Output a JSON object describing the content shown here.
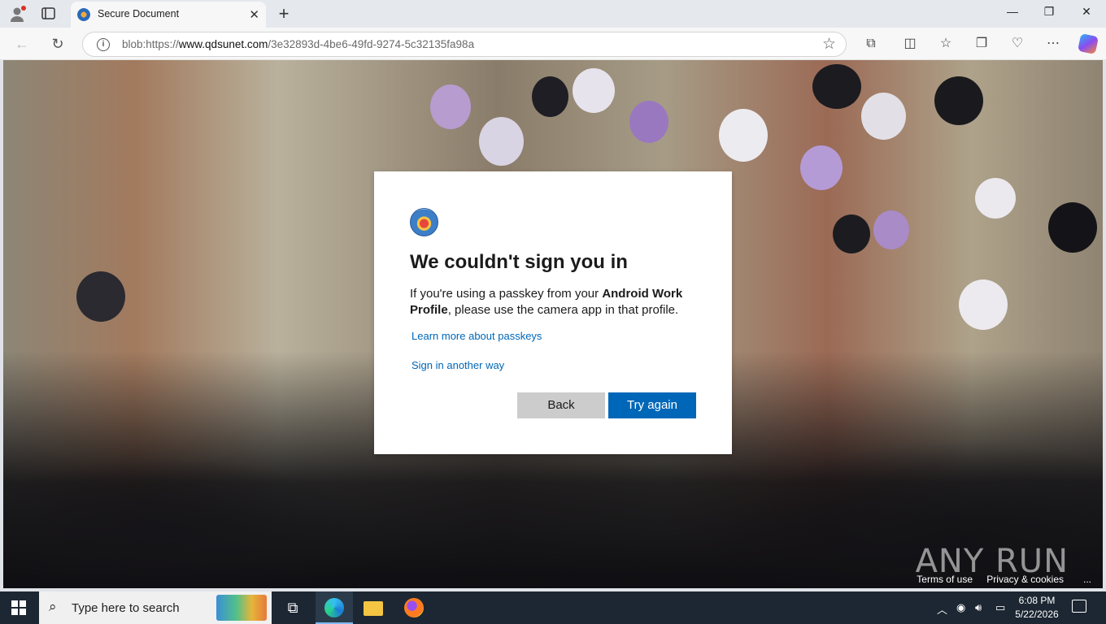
{
  "browser": {
    "tab_title": "Secure Document",
    "tab_close": "✕",
    "new_tab": "+",
    "url_prefix": "blob:https://",
    "url_domain": "www.qdsunet.com",
    "url_path": "/3e32893d-4be6-49fd-9274-5c32135fa98a",
    "window_controls": {
      "minimize": "—",
      "restore": "❐",
      "close": "✕"
    }
  },
  "dialog": {
    "title": "We couldn't sign you in",
    "message_prefix": "If you're using a passkey from your ",
    "message_bold": "Android Work Profile",
    "message_suffix": ", please use the camera app in that profile.",
    "link_learn_more": "Learn more about passkeys",
    "link_sign_in_other": "Sign in another way",
    "back_label": "Back",
    "try_again_label": "Try again"
  },
  "page_footer": {
    "terms": "Terms of use",
    "privacy": "Privacy & cookies",
    "more": "..."
  },
  "watermark": "ANY RUN",
  "taskbar": {
    "search_placeholder": "Type here to search",
    "time": "6:08 PM",
    "date": "5/22/2026"
  },
  "colors": {
    "accent": "#0067b8",
    "back_button": "#cccccc",
    "taskbar": "#1c2733"
  }
}
